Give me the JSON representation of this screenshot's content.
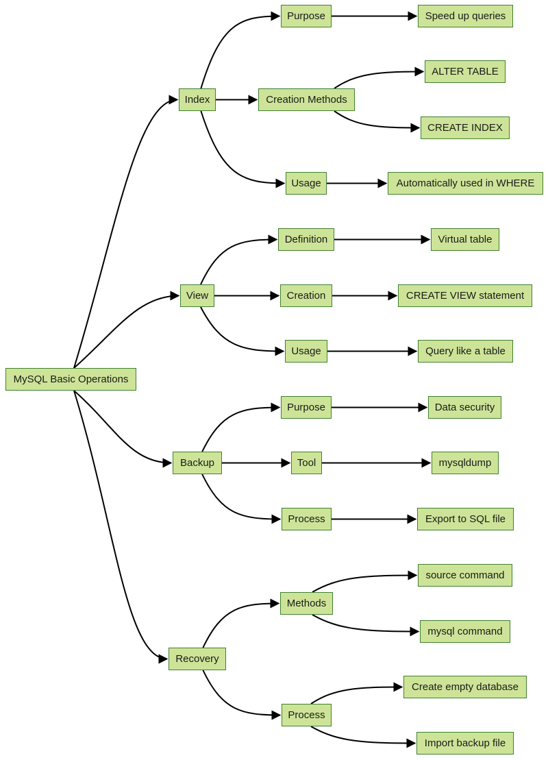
{
  "diagram": {
    "type": "mindmap-flowchart",
    "direction": "left-to-right",
    "colors": {
      "node_fill": "#cde498",
      "node_border": "#3f7f2f",
      "edge": "#000000",
      "text": "#1a1a1a"
    },
    "nodes": {
      "root": "MySQL Basic Operations",
      "index": "Index",
      "index_purpose": "Purpose",
      "index_purpose_leaf": "Speed up queries",
      "index_creation": "Creation Methods",
      "index_creation_alter": "ALTER TABLE",
      "index_creation_create": "CREATE INDEX",
      "index_usage": "Usage",
      "index_usage_leaf": "Automatically used in WHERE",
      "view": "View",
      "view_definition": "Definition",
      "view_definition_leaf": "Virtual table",
      "view_creation": "Creation",
      "view_creation_leaf": "CREATE VIEW statement",
      "view_usage": "Usage",
      "view_usage_leaf": "Query like a table",
      "backup": "Backup",
      "backup_purpose": "Purpose",
      "backup_purpose_leaf": "Data security",
      "backup_tool": "Tool",
      "backup_tool_leaf": "mysqldump",
      "backup_process": "Process",
      "backup_process_leaf": "Export to SQL file",
      "recovery": "Recovery",
      "recovery_methods": "Methods",
      "recovery_methods_source": "source command",
      "recovery_methods_mysql": "mysql command",
      "recovery_process": "Process",
      "recovery_process_create": "Create empty database",
      "recovery_process_import": "Import backup file"
    },
    "edges": [
      [
        "root",
        "index"
      ],
      [
        "root",
        "view"
      ],
      [
        "root",
        "backup"
      ],
      [
        "root",
        "recovery"
      ],
      [
        "index",
        "index_purpose"
      ],
      [
        "index",
        "index_creation"
      ],
      [
        "index",
        "index_usage"
      ],
      [
        "index_purpose",
        "index_purpose_leaf"
      ],
      [
        "index_creation",
        "index_creation_alter"
      ],
      [
        "index_creation",
        "index_creation_create"
      ],
      [
        "index_usage",
        "index_usage_leaf"
      ],
      [
        "view",
        "view_definition"
      ],
      [
        "view",
        "view_creation"
      ],
      [
        "view",
        "view_usage"
      ],
      [
        "view_definition",
        "view_definition_leaf"
      ],
      [
        "view_creation",
        "view_creation_leaf"
      ],
      [
        "view_usage",
        "view_usage_leaf"
      ],
      [
        "backup",
        "backup_purpose"
      ],
      [
        "backup",
        "backup_tool"
      ],
      [
        "backup",
        "backup_process"
      ],
      [
        "backup_purpose",
        "backup_purpose_leaf"
      ],
      [
        "backup_tool",
        "backup_tool_leaf"
      ],
      [
        "backup_process",
        "backup_process_leaf"
      ],
      [
        "recovery",
        "recovery_methods"
      ],
      [
        "recovery",
        "recovery_process"
      ],
      [
        "recovery_methods",
        "recovery_methods_source"
      ],
      [
        "recovery_methods",
        "recovery_methods_mysql"
      ],
      [
        "recovery_process",
        "recovery_process_create"
      ],
      [
        "recovery_process",
        "recovery_process_import"
      ]
    ]
  }
}
